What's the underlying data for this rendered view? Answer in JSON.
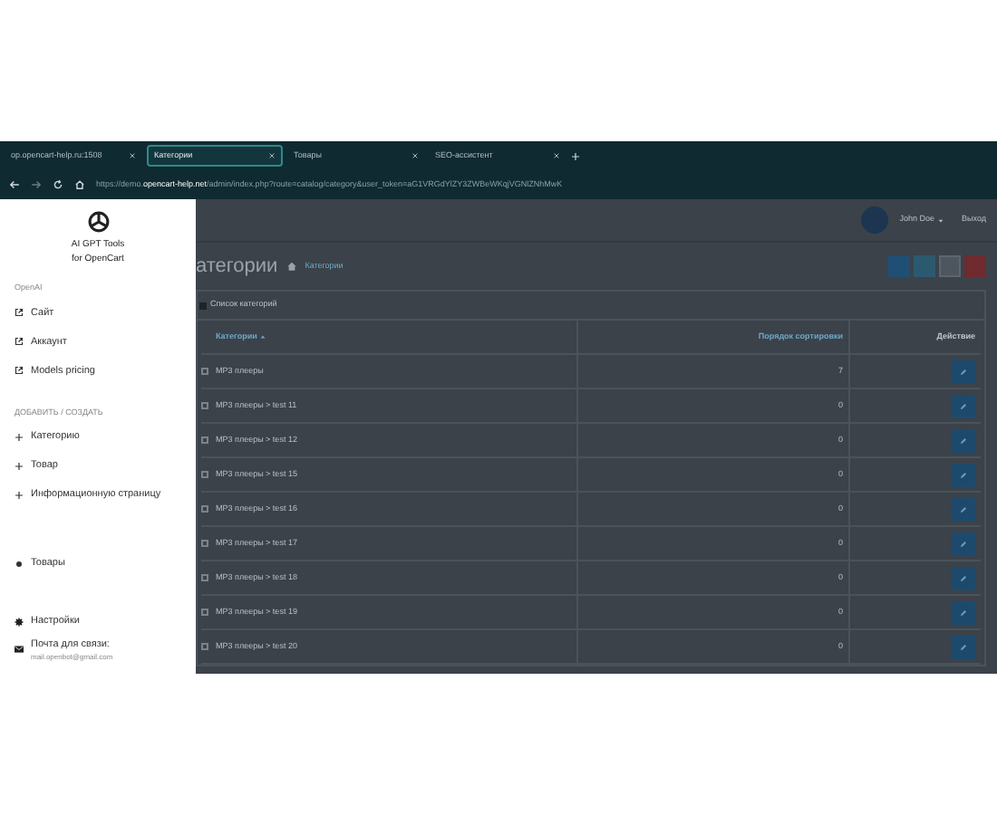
{
  "browser": {
    "tabs": [
      {
        "title": "op.opencart-help.ru:1508",
        "selected": false
      },
      {
        "title": "Категории",
        "selected": true
      },
      {
        "title": "Товары",
        "selected": false
      },
      {
        "title": "SEO-ассистент",
        "selected": false
      }
    ],
    "url_prefix": "https://demo.",
    "url_host": "opencart-help.net",
    "url_rest": "/admin/index.php?route=catalog/category&user_token=aG1VRGdYlZY3ZWBeWKqjVGNlZNhMwK"
  },
  "header": {
    "user": "John Doe",
    "logout": "Выход"
  },
  "page": {
    "title": "атегории",
    "breadcrumb": "Категории",
    "panel_title": "Список категорий",
    "columns": [
      "Категории",
      "Порядок сортировки",
      "Действие"
    ],
    "rows": [
      {
        "name": "MP3 плееры",
        "sort": "7",
        "checked": false
      },
      {
        "name": "MP3 плееры > test 11",
        "sort": "0",
        "checked": false
      },
      {
        "name": "MP3 плееры > test 12",
        "sort": "0",
        "checked": false
      },
      {
        "name": "MP3 плееры > test 15",
        "sort": "0",
        "checked": false
      },
      {
        "name": "MP3 плееры > test 16",
        "sort": "0",
        "checked": false
      },
      {
        "name": "MP3 плееры > test 17",
        "sort": "0",
        "checked": false
      },
      {
        "name": "MP3 плееры > test 18",
        "sort": "0",
        "checked": false
      },
      {
        "name": "MP3 плееры > test 19",
        "sort": "0",
        "checked": false
      },
      {
        "name": "MP3 плееры > test 20",
        "sort": "0",
        "checked": false
      }
    ]
  },
  "sidebar": {
    "title": [
      "AI GPT Tools",
      "for OpenCart"
    ],
    "sections": [
      {
        "heading": "OpenAI",
        "items": [
          {
            "kind": "link",
            "label": "Сайт"
          },
          {
            "kind": "link",
            "label": "Аккаунт"
          },
          {
            "kind": "link",
            "label": "Models pricing"
          }
        ]
      },
      {
        "heading": "ДОБАВИТЬ / СОЗДАТЬ",
        "items": [
          {
            "kind": "add",
            "label": "Категорию"
          },
          {
            "kind": "add",
            "label": "Товар"
          },
          {
            "kind": "add",
            "label": "Информационную страницу"
          }
        ]
      }
    ],
    "products": {
      "kind": "dot",
      "label": "Товары"
    },
    "settings": "Настройки",
    "mail_label": "Почта для связи:",
    "mail": "mail.openbot@gmail.com"
  }
}
